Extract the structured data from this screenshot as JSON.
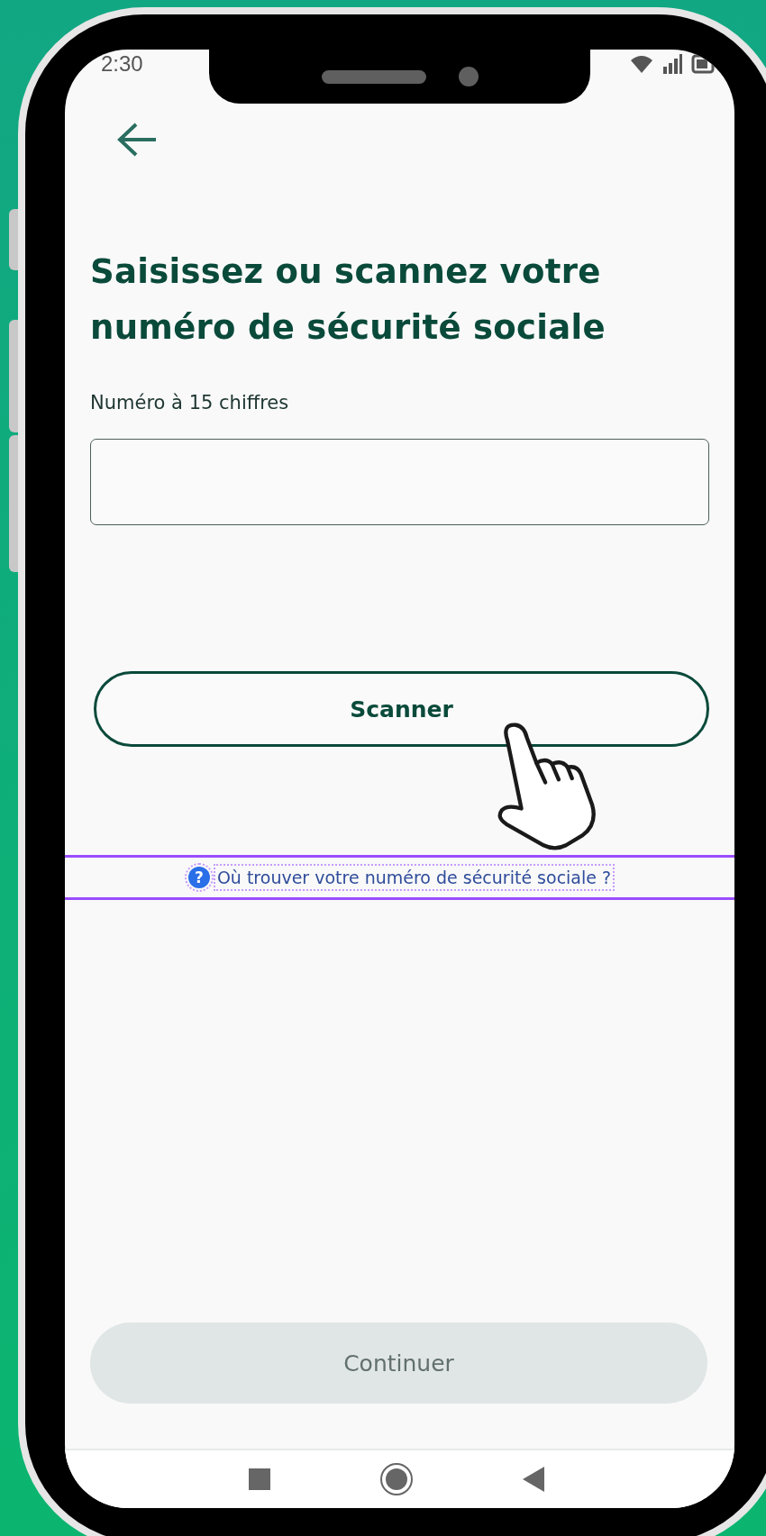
{
  "status_bar": {
    "time": "2:30"
  },
  "title": "Saisissez ou scannez votre numéro de sécurité sociale",
  "number_field": {
    "label": "Numéro à 15 chiffres"
  },
  "scan_button": {
    "label": "Scanner"
  },
  "help_link": {
    "label": "Où trouver votre numéro de sécurité sociale ?",
    "icon": "?"
  },
  "continue_button": {
    "label": "Continuer",
    "disabled": true
  },
  "nav_bar": {
    "buttons": [
      {
        "kind": "square"
      },
      {
        "kind": "circle"
      },
      {
        "kind": "triangle"
      }
    ]
  }
}
